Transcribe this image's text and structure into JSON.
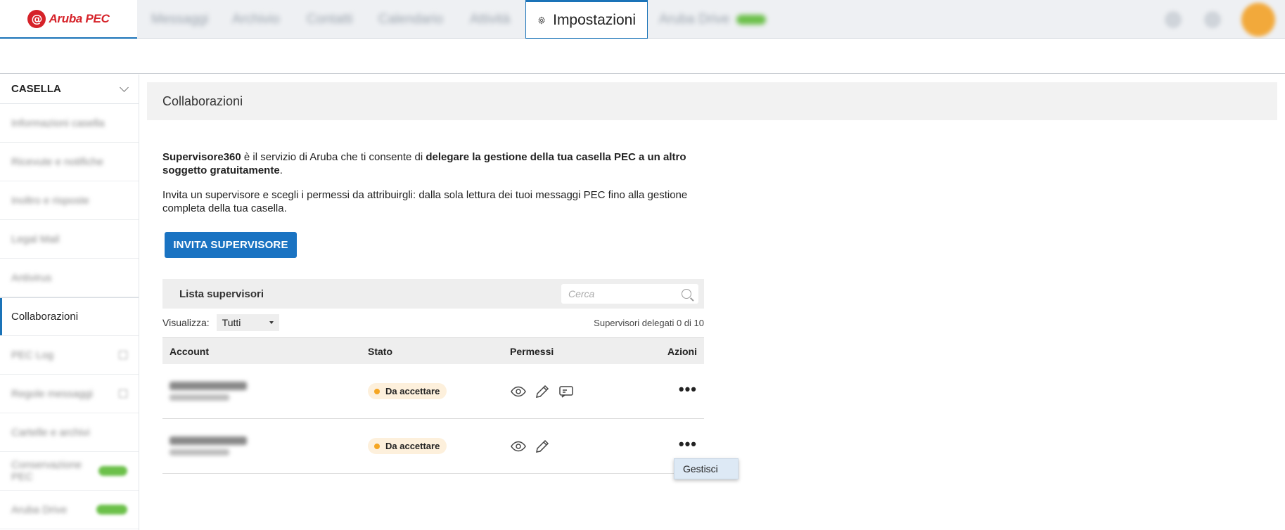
{
  "header": {
    "logo_symbol": "@",
    "logo_text": "Aruba PEC",
    "tabs": [
      {
        "label": "Messaggi"
      },
      {
        "label": "Archivio"
      },
      {
        "label": "Contatti"
      },
      {
        "label": "Calendario"
      },
      {
        "label": "Attività"
      },
      {
        "label": "Impostazioni"
      },
      {
        "label": "Aruba Drive"
      }
    ]
  },
  "sidebar": {
    "section_title": "CASELLA",
    "items": [
      {
        "label": "Informazioni casella"
      },
      {
        "label": "Ricevute e notifiche"
      },
      {
        "label": "Inoltro e risposte"
      },
      {
        "label": "Legal Mail"
      },
      {
        "label": "Antivirus"
      },
      {
        "label": "Collaborazioni"
      },
      {
        "label": "PEC Log"
      },
      {
        "label": "Regole messaggi"
      },
      {
        "label": "Cartelle e archivi"
      },
      {
        "label": "Conservazione PEC"
      },
      {
        "label": "Aruba Drive"
      }
    ]
  },
  "main": {
    "page_title": "Collaborazioni",
    "intro": {
      "p1_strong1": "Supervisore360",
      "p1_text1": " è il servizio di Aruba che ti consente di ",
      "p1_strong2": "delegare la gestione della tua casella PEC a un altro soggetto gratuitamente",
      "p1_text2": ".",
      "p2": "Invita un supervisore e scegli i permessi da attribuirgli: dalla sola lettura dei tuoi messaggi PEC fino alla gestione completa della tua casella."
    },
    "invite_button": "INVITA SUPERVISORE",
    "list_title": "Lista supervisori",
    "search_placeholder": "Cerca",
    "filter_label": "Visualizza:",
    "filter_value": "Tutti",
    "count_text": "Supervisori delegati 0 di 10",
    "columns": {
      "account": "Account",
      "status": "Stato",
      "permissions": "Permessi",
      "actions": "Azioni"
    },
    "rows": [
      {
        "account_name": "Nome Cognome",
        "account_sub": "indirizzo@pec.it",
        "status": "Da accettare",
        "permissions": [
          "eye-icon",
          "pencil-icon",
          "message-icon"
        ]
      },
      {
        "account_name": "Nome Cognome",
        "account_sub": "indirizzo@pec.it",
        "status": "Da accettare",
        "permissions": [
          "eye-icon",
          "pencil-icon"
        ]
      }
    ],
    "actions_symbol": "•••",
    "context_menu": {
      "item": "Gestisci"
    }
  },
  "colors": {
    "accent": "#1a73c2",
    "brand": "#d62229",
    "pending_dot": "#f5a623",
    "pending_bg": "#fdf0dc"
  }
}
